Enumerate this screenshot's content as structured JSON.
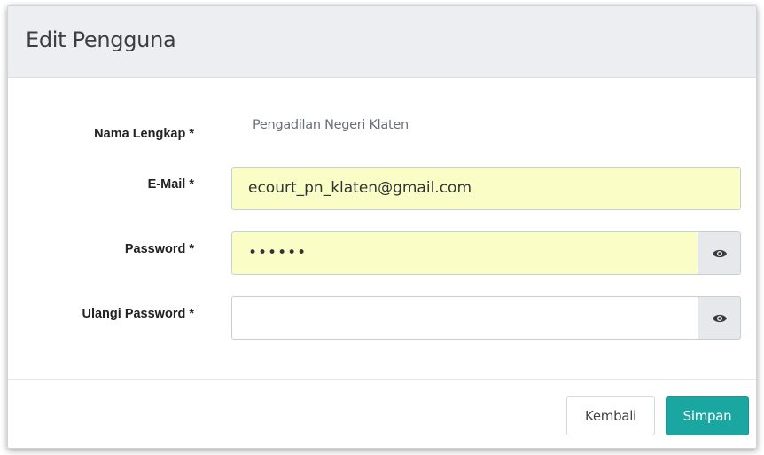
{
  "modal": {
    "title": "Edit Pengguna"
  },
  "form": {
    "nama": {
      "label": "Nama Lengkap *",
      "value": "Pengadilan Negeri Klaten"
    },
    "email": {
      "label": "E-Mail *",
      "value": "ecourt_pn_klaten@gmail.com"
    },
    "password": {
      "label": "Password *",
      "value": "••••••"
    },
    "ulangi_password": {
      "label": "Ulangi Password *",
      "value": ""
    }
  },
  "icons": {
    "password_toggle": "eye-icon",
    "ulangi_toggle": "eye-icon"
  },
  "footer": {
    "back_label": "Kembali",
    "save_label": "Simpan"
  },
  "colors": {
    "autofill_bg": "#fafdc6",
    "primary": "#1aa6a1",
    "header_bg": "#eceef1"
  }
}
